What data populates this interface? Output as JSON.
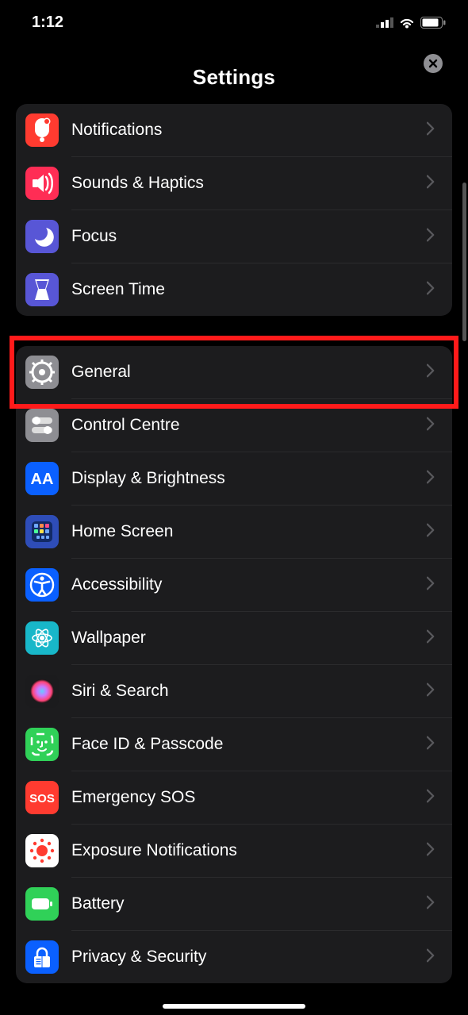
{
  "status": {
    "time": "1:12"
  },
  "header": {
    "title": "Settings"
  },
  "group1": [
    {
      "key": "notifications",
      "label": "Notifications",
      "bg": "#ff3b30"
    },
    {
      "key": "sounds",
      "label": "Sounds & Haptics",
      "bg": "#ff2d55"
    },
    {
      "key": "focus",
      "label": "Focus",
      "bg": "#5856d6"
    },
    {
      "key": "screentime",
      "label": "Screen Time",
      "bg": "#5856d6"
    }
  ],
  "group2": [
    {
      "key": "general",
      "label": "General",
      "bg": "#8e8e93"
    },
    {
      "key": "controlcentre",
      "label": "Control Centre",
      "bg": "#8e8e93"
    },
    {
      "key": "display",
      "label": "Display & Brightness",
      "bg": "#0a60ff"
    },
    {
      "key": "homescreen",
      "label": "Home Screen",
      "bg": "#2e4db8"
    },
    {
      "key": "accessibility",
      "label": "Accessibility",
      "bg": "#0a60ff"
    },
    {
      "key": "wallpaper",
      "label": "Wallpaper",
      "bg": "#18b7c9"
    },
    {
      "key": "siri",
      "label": "Siri & Search",
      "bg": "#1b1b1d"
    },
    {
      "key": "faceid",
      "label": "Face ID & Passcode",
      "bg": "#30d158"
    },
    {
      "key": "sos",
      "label": "Emergency SOS",
      "bg": "#ff3b30"
    },
    {
      "key": "exposure",
      "label": "Exposure Notifications",
      "bg": "#ffffff"
    },
    {
      "key": "battery",
      "label": "Battery",
      "bg": "#30d158"
    },
    {
      "key": "privacy",
      "label": "Privacy & Security",
      "bg": "#0a60ff"
    }
  ],
  "highlight_key": "general"
}
